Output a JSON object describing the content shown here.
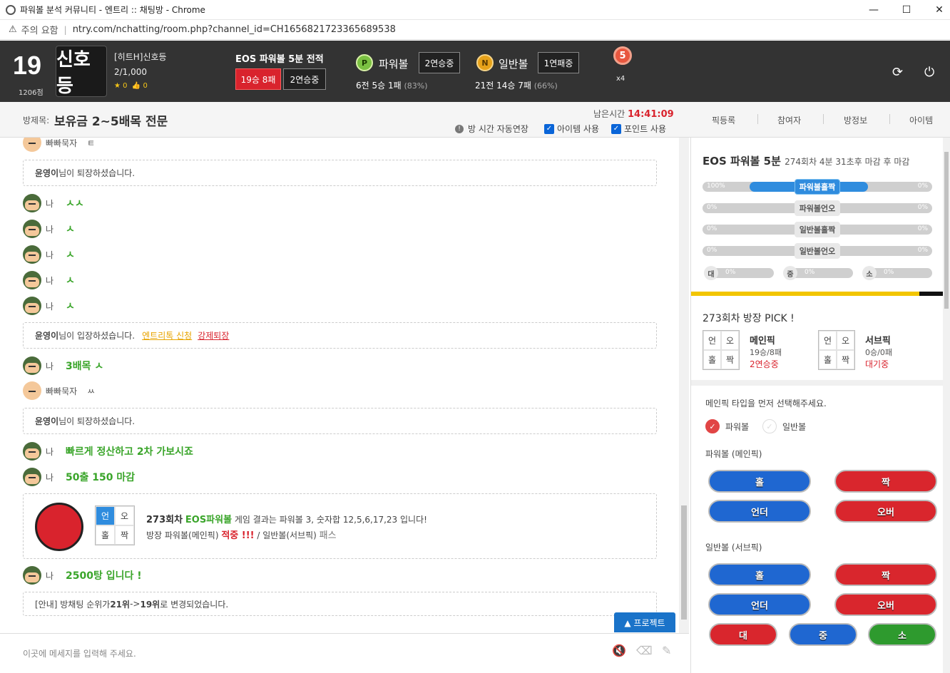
{
  "window": {
    "title": "파워볼 분석 커뮤니티 - 엔트리 :: 채팅방 - Chrome",
    "minimize": "—",
    "maximize": "☐",
    "close": "✕"
  },
  "address": {
    "warning_label": "주의 요함",
    "url": "ntry.com/nchatting/room.php?channel_id=CH1656821723365689538"
  },
  "profile": {
    "level": "19",
    "points": "1206점",
    "avatar_text": "신호등",
    "name": "[히트H]신호등",
    "count": "2/1,000",
    "stars": "0",
    "likes": "0"
  },
  "eos_record": {
    "title": "EOS 파워볼 5분 전적",
    "record": "19승 8패",
    "streak": "2연승중"
  },
  "powerball": {
    "icon": "P",
    "label": "파워볼",
    "streak": "2연승중",
    "stat": "6전 5승 1패",
    "pct": "(83%)"
  },
  "normalball": {
    "icon": "N",
    "label": "일반볼",
    "streak": "1연패중",
    "stat": "21전 14승 7패",
    "pct": "(66%)"
  },
  "medal": {
    "number": "5",
    "count": "x4"
  },
  "room": {
    "label": "방제목:",
    "title": "보유금 2~5배목 전문",
    "remain_label": "남은시간",
    "remain_time": "14:41:09",
    "opt_extend": "방 시간 자동연장",
    "opt_item": "아이템 사용",
    "opt_point": "포인트 사용"
  },
  "tabs": [
    "픽등록",
    "참여자",
    "방정보",
    "아이템"
  ],
  "chat": {
    "top_user": "빠빠묵자",
    "top_msg": "ㅌ",
    "leave1": {
      "name": "윤영이",
      "text": "님이 퇴장하셨습니다."
    },
    "me": "나",
    "m1": "ㅅㅅ",
    "m2": "ㅅ",
    "m3": "ㅅ",
    "m4": "ㅅ",
    "m5": "ㅅ",
    "enter": {
      "name": "윤영이",
      "text": "님이 입장하셨습니다.",
      "link1": "엔트리톡 신청",
      "link2": "강제퇴장"
    },
    "m6": "3배목 ㅅ",
    "bbb_name": "빠빠묵자",
    "bbb_msg": "ㅆ",
    "leave2": {
      "name": "윤영이",
      "text": "님이 퇴장하셨습니다."
    },
    "m7": "빠르게 정산하고 2차 가보시죠",
    "m8": "50출 150 마감",
    "result": {
      "round": "273회차",
      "game": "EOS파워볼",
      "text": " 게임 결과는 파워볼 3, 숫자합 12,5,6,17,23 입니다!",
      "owner": "방장 파워볼(메인픽)",
      "hit": "적중 !!!",
      "sep": " / 일반볼(서브픽)",
      "pass": "패스",
      "grid": [
        "언",
        "오",
        "홀",
        "짝"
      ]
    },
    "m9": "2500탕 입니다 !",
    "rank": {
      "prefix": "[안내] 방채팅 순위가 ",
      "from": "21위",
      "arrow": " -> ",
      "to": "19위",
      "suffix": " 로 변경되었습니다."
    }
  },
  "project_button": "▲ 프로젝트",
  "input": {
    "placeholder": "이곳에 메세지를 입력해 주세요."
  },
  "right": {
    "eos_title": "EOS 파워볼 5분",
    "eos_sub": "274회차 4분 31초후 마감 후 마감",
    "bars": [
      {
        "label": "파워볼홀짝",
        "left": "100%",
        "right": "0%",
        "fill": 1.0,
        "active": true
      },
      {
        "label": "파워볼언오",
        "left": "0%",
        "right": "0%",
        "fill": 0,
        "active": false
      },
      {
        "label": "일반볼홀짝",
        "left": "0%",
        "right": "0%",
        "fill": 0,
        "active": false
      },
      {
        "label": "일반볼언오",
        "left": "0%",
        "right": "0%",
        "fill": 0,
        "active": false
      }
    ],
    "mini": [
      {
        "c": "대",
        "v": "0%"
      },
      {
        "c": "중",
        "v": "0%"
      },
      {
        "c": "소",
        "v": "0%"
      }
    ],
    "pick_title": "273회차 방장 PICK !",
    "main_pick": {
      "title": "메인픽",
      "record": "19승/8패",
      "status": "2연승중",
      "grid": [
        "언",
        "오",
        "홀",
        "짝"
      ]
    },
    "sub_pick": {
      "title": "서브픽",
      "record": "0승/0패",
      "status": "대기중",
      "grid": [
        "언",
        "오",
        "홀",
        "짝"
      ]
    },
    "choose": "메인픽 타입을 먼저 선택해주세요.",
    "radio_power": "파워볼",
    "radio_normal": "일반볼",
    "sect_power": "파워볼 (메인픽)",
    "sect_normal": "일반볼 (서브픽)",
    "btn": {
      "hol": "홀",
      "jjak": "짝",
      "under": "언더",
      "over": "오버",
      "dae": "대",
      "jung": "중",
      "so": "소"
    }
  }
}
